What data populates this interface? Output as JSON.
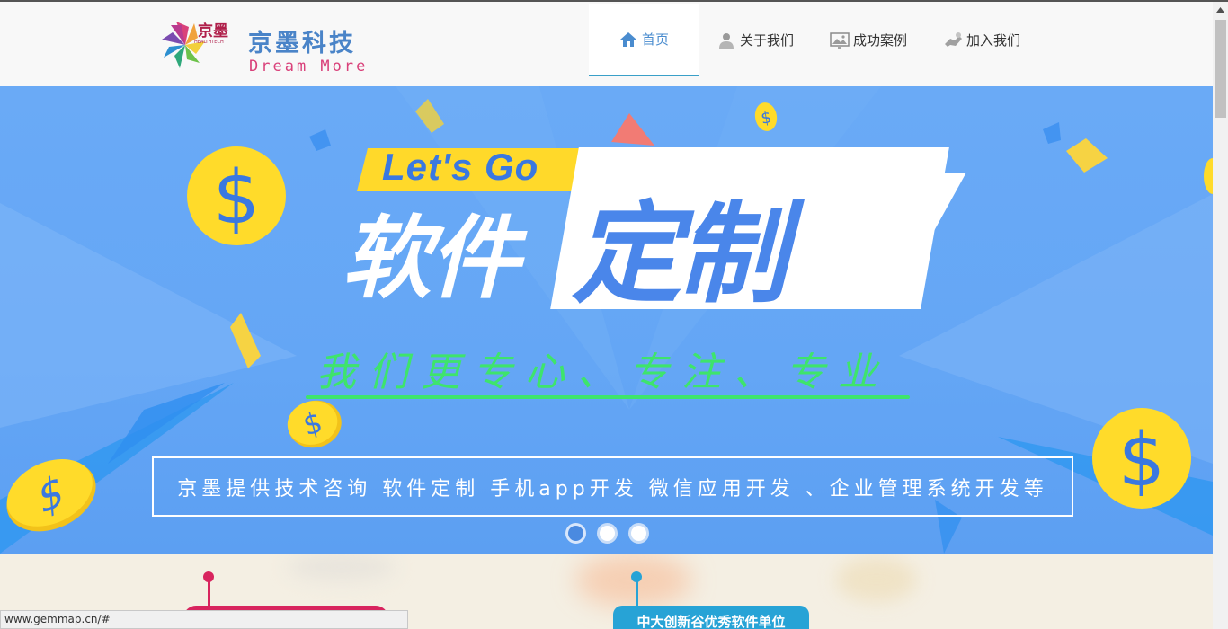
{
  "brand": {
    "mark_text": "京墨",
    "mark_small": "HEALTHTECH",
    "name_cn": "京墨科技",
    "tagline": "Dream More"
  },
  "nav": {
    "items": [
      {
        "label": "首页",
        "icon": "home-icon"
      },
      {
        "label": "关于我们",
        "icon": "user-icon"
      },
      {
        "label": "成功案例",
        "icon": "picture-icon"
      },
      {
        "label": "加入我们",
        "icon": "handshake-icon"
      }
    ]
  },
  "banner": {
    "badge": "Let's Go",
    "headline_part1": "软件",
    "headline_part2": "定制",
    "exclaim": "!",
    "slogan": "我们更专心、专注、专业",
    "caption": "京墨提供技术咨询 软件定制 手机app开发 微信应用开发 、企业管理系统开发等",
    "slides": 3,
    "active_slide": 1,
    "colors": {
      "sky": "#64a6f5",
      "coin": "#ffd92a",
      "slogan": "#3ee46c"
    }
  },
  "timeline": {
    "item_blue_label": "中大创新谷优秀软件单位",
    "colors": {
      "red": "#d8245e",
      "blue": "#27a3d6"
    }
  },
  "statusbar": {
    "url": "www.gemmap.cn/#"
  }
}
